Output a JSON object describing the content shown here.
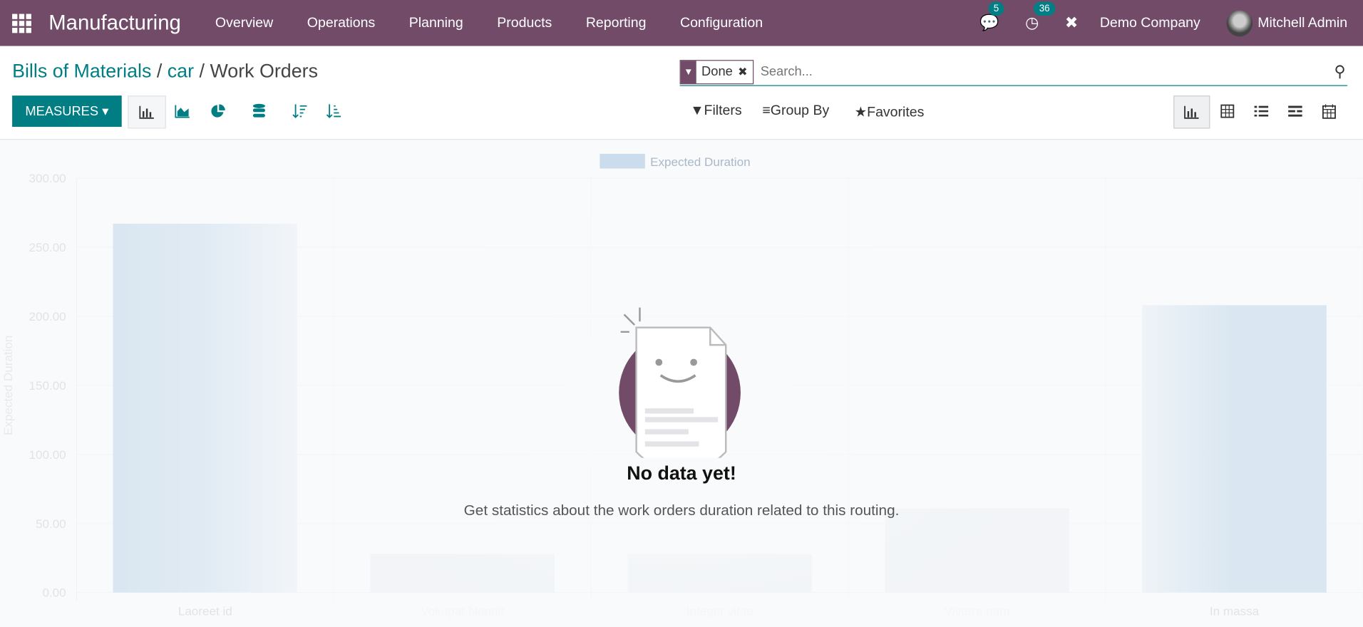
{
  "navbar": {
    "app": "Manufacturing",
    "menu": [
      "Overview",
      "Operations",
      "Planning",
      "Products",
      "Reporting",
      "Configuration"
    ],
    "messages_count": "5",
    "activities_count": "36",
    "company": "Demo Company",
    "user": "Mitchell Admin"
  },
  "breadcrumb": {
    "items": [
      "Bills of Materials",
      "car"
    ],
    "current": "Work Orders",
    "sep": "/"
  },
  "search": {
    "facet": "Done",
    "placeholder": "Search..."
  },
  "toolbar": {
    "measures": "MEASURES",
    "filters": "Filters",
    "group_by": "Group By",
    "favorites": "Favorites"
  },
  "graph_modes": [
    "bar-chart-icon",
    "line-chart-icon",
    "pie-chart-icon",
    "stacked-icon",
    "sort-descending-icon",
    "sort-ascending-icon"
  ],
  "views": [
    "graph-view-icon",
    "pivot-view-icon",
    "list-view-icon",
    "gantt-view-icon",
    "calendar-view-icon"
  ],
  "empty": {
    "title": "No data yet!",
    "text": "Get statistics about the work orders duration related to this routing."
  },
  "colors": {
    "navbar": "#714b67",
    "accent": "#017e84",
    "bar": "#b3cfe5"
  },
  "chart_data": {
    "type": "bar",
    "categories": [
      "Laoreet id",
      "Volutpat blandit",
      "Integer vitae",
      "Viverra nam",
      "In massa"
    ],
    "series": [
      {
        "name": "Expected Duration",
        "values": [
          267,
          28,
          28,
          61,
          208
        ]
      }
    ],
    "ylabel": "Expected Duration",
    "ylim": [
      0,
      300
    ],
    "yticks": [
      "0.00",
      "50.00",
      "100.00",
      "150.00",
      "200.00",
      "250.00",
      "300.00"
    ],
    "legend": "top",
    "grid": true
  }
}
